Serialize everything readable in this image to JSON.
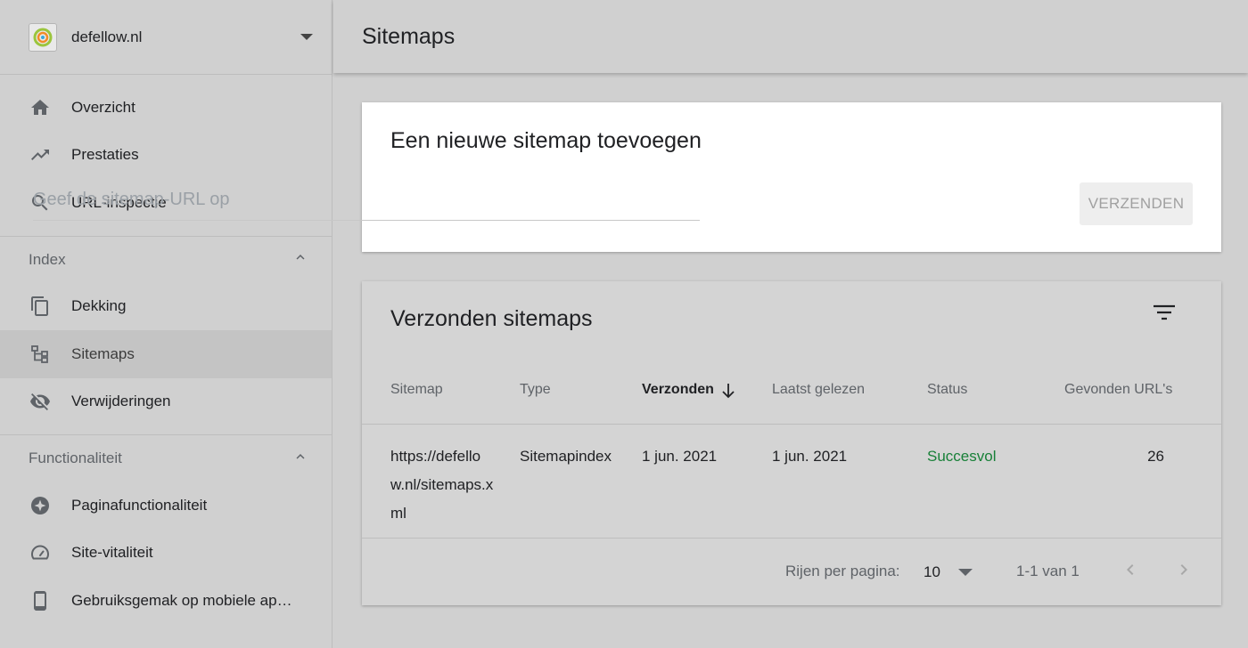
{
  "property": {
    "name": "defellow.nl"
  },
  "nav": {
    "main": [
      {
        "label": "Overzicht",
        "icon": "home-icon"
      },
      {
        "label": "Prestaties",
        "icon": "trending-up-icon"
      },
      {
        "label": "URL-inspectie",
        "icon": "search-icon"
      }
    ],
    "index_section": "Index",
    "index_items": [
      {
        "label": "Dekking",
        "icon": "copy-pages-icon"
      },
      {
        "label": "Sitemaps",
        "icon": "sitemap-icon",
        "active": true
      },
      {
        "label": "Verwijderingen",
        "icon": "eye-off-icon"
      }
    ],
    "func_section": "Functionaliteit",
    "func_items": [
      {
        "label": "Paginafunctionaliteit",
        "icon": "page-experience-icon"
      },
      {
        "label": "Site-vitaliteit",
        "icon": "gauge-icon"
      },
      {
        "label": "Gebruiksgemak op mobiele ap…",
        "icon": "smartphone-icon"
      }
    ]
  },
  "header": {
    "title": "Sitemaps"
  },
  "add_card": {
    "title": "Een nieuwe sitemap toevoegen",
    "placeholder": "Geef de sitemap-URL op",
    "submit_label": "VERZENDEN"
  },
  "list_card": {
    "title": "Verzonden sitemaps",
    "columns": {
      "sitemap": "Sitemap",
      "type": "Type",
      "submitted": "Verzonden",
      "last_read": "Laatst gelezen",
      "status": "Status",
      "urls": "Gevonden URL's"
    },
    "rows": [
      {
        "sitemap": "https://defellow.nl/sitemaps.xml",
        "type": "Sitemapindex",
        "submitted": "1 jun. 2021",
        "last_read": "1 jun. 2021",
        "status": "Succesvol",
        "urls": "26"
      }
    ],
    "footer": {
      "rows_per_page_label": "Rijen per pagina:",
      "rows_per_page_value": "10",
      "range": "1-1 van 1"
    }
  },
  "colors": {
    "background": "#d0d0d0",
    "status_success": "#188038",
    "active_nav": "#c4c4c4"
  }
}
